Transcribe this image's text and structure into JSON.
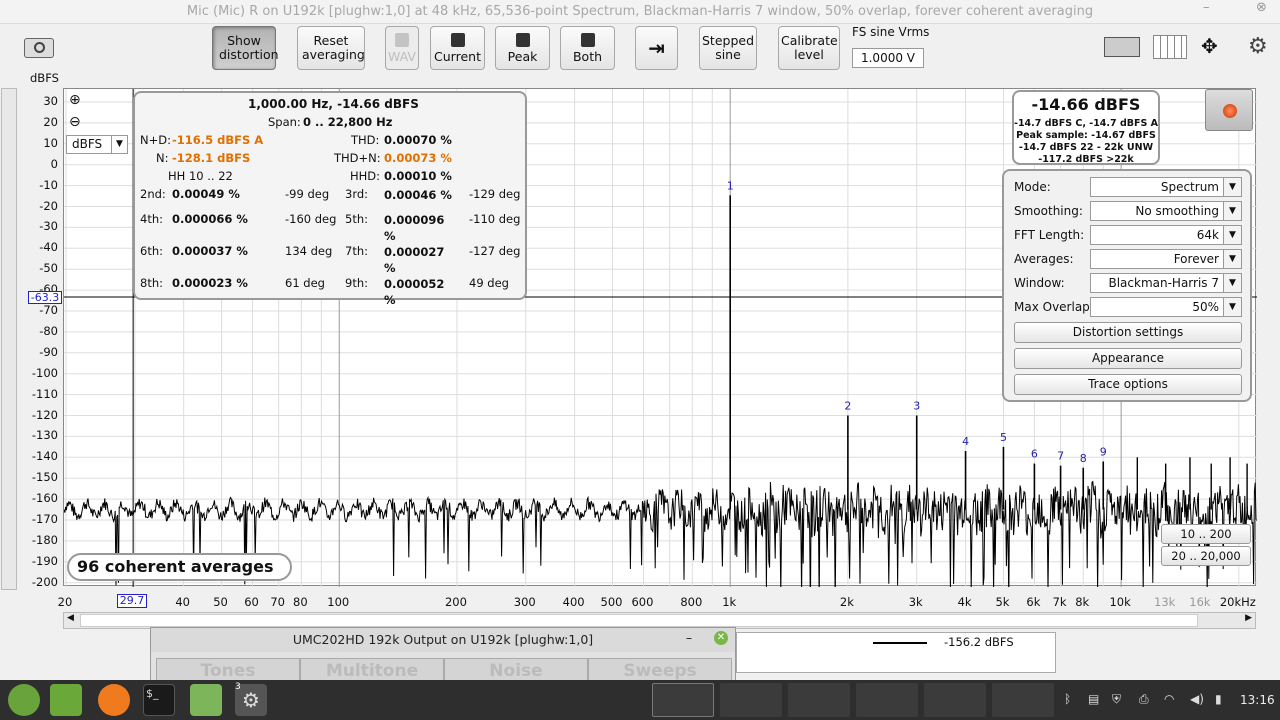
{
  "window": {
    "title": "Mic (Mic) R on U192k [plughw:1,0] at 48 kHz, 65,536-point Spectrum, Blackman-Harris 7 window, 50% overlap, forever coherent averaging",
    "minimize": "–",
    "close": "⊗"
  },
  "toolbar": {
    "show_distortion": "Show distortion",
    "reset_averaging": "Reset averaging",
    "wav": "WAV",
    "current": "Current",
    "peak": "Peak",
    "both": "Both",
    "stepped_sine": "Stepped sine",
    "calibrate_level": "Calibrate level",
    "fs_label": "FS sine Vrms",
    "fs_value": "1.0000 V"
  },
  "y_axis": {
    "unit": "dBFS",
    "ticks": [
      "30",
      "20",
      "10",
      "0",
      "-10",
      "-20",
      "-30",
      "-40",
      "-50",
      "-60",
      "-70",
      "-80",
      "-90",
      "-100",
      "-110",
      "-120",
      "-130",
      "-140",
      "-150",
      "-160",
      "-170",
      "-180",
      "-190",
      "-200"
    ],
    "cursor": "-63.3",
    "unit_select": "dBFS"
  },
  "x_axis": {
    "ticks": [
      {
        "l": "20",
        "g": false
      },
      {
        "l": "40",
        "g": false
      },
      {
        "l": "50",
        "g": false
      },
      {
        "l": "60",
        "g": false
      },
      {
        "l": "70",
        "g": false
      },
      {
        "l": "80",
        "g": false
      },
      {
        "l": "100",
        "g": false
      },
      {
        "l": "200",
        "g": false
      },
      {
        "l": "300",
        "g": false
      },
      {
        "l": "400",
        "g": false
      },
      {
        "l": "500",
        "g": false
      },
      {
        "l": "600",
        "g": false
      },
      {
        "l": "800",
        "g": false
      },
      {
        "l": "1k",
        "g": false
      },
      {
        "l": "2k",
        "g": false
      },
      {
        "l": "3k",
        "g": false
      },
      {
        "l": "4k",
        "g": false
      },
      {
        "l": "5k",
        "g": false
      },
      {
        "l": "6k",
        "g": false
      },
      {
        "l": "7k",
        "g": false
      },
      {
        "l": "8k",
        "g": false
      },
      {
        "l": "10k",
        "g": false
      },
      {
        "l": "13k",
        "g": true
      },
      {
        "l": "16k",
        "g": true
      },
      {
        "l": "20kHz",
        "g": false
      }
    ],
    "cursor": "29.7"
  },
  "distortion": {
    "header": "1,000.00 Hz, -14.66 dBFS",
    "span_label": "Span:",
    "span_value": "0 .. 22,800 Hz",
    "nd_label": "N+D:",
    "nd_value": "-116.5 dBFS A",
    "n_label": "N:",
    "n_value": "-128.1 dBFS",
    "hh": "HH 10 .. 22",
    "thd_label": "THD:",
    "thd_value": "0.00070 %",
    "thdn_label": "THD+N:",
    "thdn_value": "0.00073 %",
    "hhd_label": "HHD:",
    "hhd_value": "0.00010 %",
    "harmonics": [
      [
        "2nd:",
        "0.00049 %",
        "-99 deg",
        "3rd:",
        "0.00046 %",
        "-129 deg"
      ],
      [
        "4th:",
        "0.000066 %",
        "-160 deg",
        "5th:",
        "0.000096 %",
        "-110 deg"
      ],
      [
        "6th:",
        "0.000037 %",
        "134 deg",
        "7th:",
        "0.000027 %",
        "-127 deg"
      ],
      [
        "8th:",
        "0.000023 %",
        "61 deg",
        "9th:",
        "0.000052 %",
        "49 deg"
      ]
    ]
  },
  "readout": {
    "main": "-14.66 dBFS",
    "l1": "-14.7 dBFS C, -14.7 dBFS A",
    "l2": "Peak sample: -14.67 dBFS",
    "l3": "-14.7 dBFS 22 - 22k UNW",
    "l4": "-117.2 dBFS >22k"
  },
  "controls": {
    "mode_label": "Mode:",
    "mode": "Spectrum",
    "smoothing_label": "Smoothing:",
    "smoothing": "No  smoothing",
    "fft_label": "FFT Length:",
    "fft": "64k",
    "avg_label": "Averages:",
    "avg": "Forever",
    "window_label": "Window:",
    "window": "Blackman-Harris 7",
    "overlap_label": "Max Overlap:",
    "overlap": "50%",
    "dist_settings": "Distortion settings",
    "appearance": "Appearance",
    "trace_options": "Trace options"
  },
  "ranges": {
    "r1": "10 .. 200",
    "r2": "20 .. 20,000"
  },
  "averages": "96 coherent averages",
  "generator": {
    "title": "UMC202HD 192k Output on U192k [plughw:1,0]",
    "tabs": [
      "Tones",
      "Multitone",
      "Noise",
      "Sweeps"
    ]
  },
  "legend": {
    "value": "-156.2 dBFS"
  },
  "taskbar": {
    "clock": "13:16",
    "badge": "3"
  },
  "chart_data": {
    "type": "line",
    "xlabel": "",
    "ylabel": "dBFS",
    "ylim": [
      -200,
      35
    ],
    "xscale": "log",
    "xlim": [
      20,
      22000
    ],
    "peaks": [
      {
        "label": "1",
        "x": 1000,
        "y": -14.7
      },
      {
        "label": "2",
        "x": 2000,
        "y": -120
      },
      {
        "label": "3",
        "x": 3000,
        "y": -120
      },
      {
        "label": "4",
        "x": 4000,
        "y": -137
      },
      {
        "label": "5",
        "x": 5000,
        "y": -135
      },
      {
        "label": "6",
        "x": 6000,
        "y": -143
      },
      {
        "label": "7",
        "x": 7000,
        "y": -144
      },
      {
        "label": "8",
        "x": 8000,
        "y": -145
      },
      {
        "label": "9",
        "x": 9000,
        "y": -142
      }
    ],
    "noise_floor": -165
  }
}
